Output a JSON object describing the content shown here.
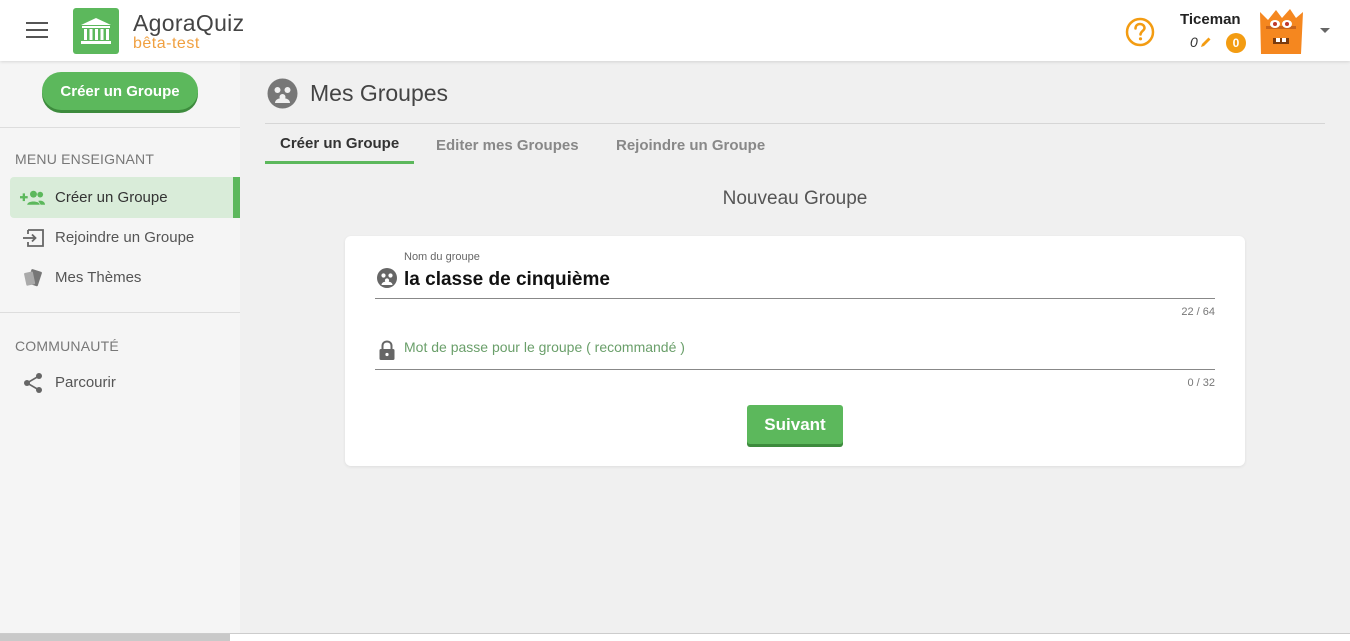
{
  "header": {
    "app_name": "AgoraQuiz",
    "app_subtitle": "bêta-test",
    "username": "Ticeman",
    "edit_score": "0",
    "badge_count": "0"
  },
  "sidebar": {
    "create_button": "Créer un Groupe",
    "teacher_section": "MENU ENSEIGNANT",
    "teacher_items": [
      {
        "label": "Créer un Groupe",
        "icon": "add-group-icon",
        "active": true
      },
      {
        "label": "Rejoindre un Groupe",
        "icon": "join-icon",
        "active": false
      },
      {
        "label": "Mes Thèmes",
        "icon": "themes-icon",
        "active": false
      }
    ],
    "community_section": "COMMUNAUTÉ",
    "community_items": [
      {
        "label": "Parcourir",
        "icon": "share-icon",
        "active": false
      }
    ]
  },
  "main": {
    "page_title": "Mes Groupes",
    "tabs": [
      {
        "label": "Créer un Groupe",
        "active": true
      },
      {
        "label": "Editer mes Groupes",
        "active": false
      },
      {
        "label": "Rejoindre un Groupe",
        "active": false
      }
    ],
    "form_title": "Nouveau Groupe",
    "name_field": {
      "label": "Nom du groupe",
      "value": "la classe de cinquième",
      "counter": "22 / 64"
    },
    "password_field": {
      "placeholder": "Mot de passe pour le groupe ( recommandé )",
      "value": "",
      "counter": "0 / 32"
    },
    "next_button": "Suivant"
  },
  "colors": {
    "accent": "#5cb85c",
    "accent_dark": "#3d8b3d",
    "orange": "#f39c12",
    "subtitle": "#f0a040"
  }
}
